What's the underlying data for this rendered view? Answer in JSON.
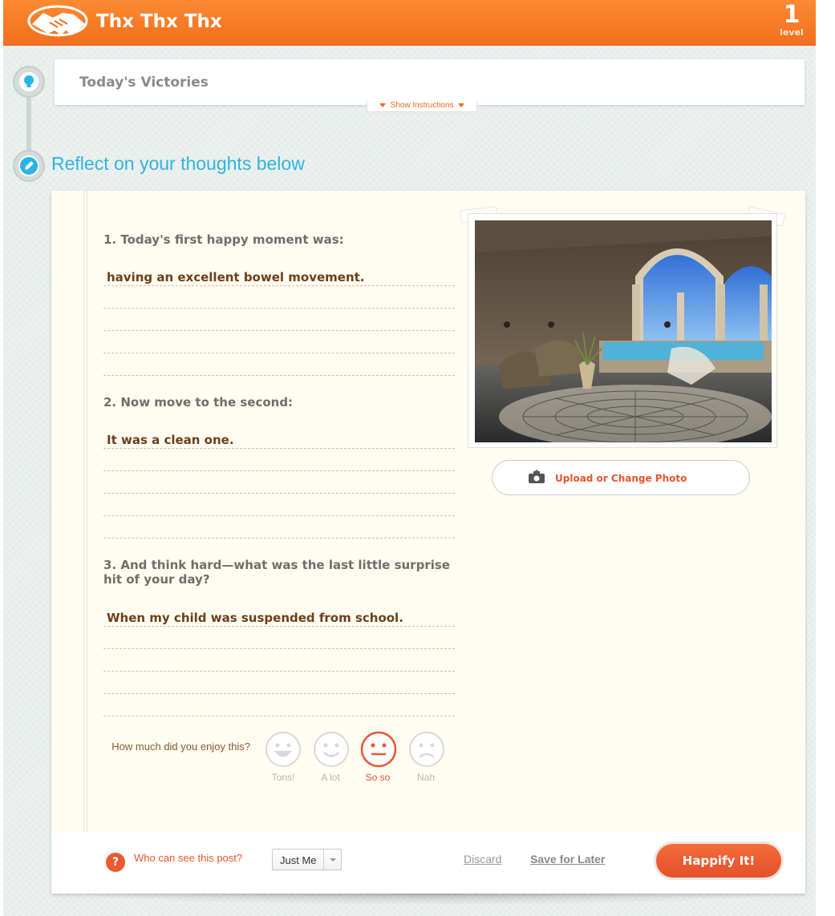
{
  "header": {
    "app_title": "Thx Thx Thx",
    "level_number": "1",
    "level_label": "level"
  },
  "steps": {
    "victories_title": "Today's Victories",
    "show_instructions": "Show Instructions",
    "reflect_title": "Reflect on your thoughts below"
  },
  "questions": [
    {
      "prompt": "1. Today's first happy moment was:",
      "answer": "having an excellent bowel movement."
    },
    {
      "prompt": "2. Now move to the second:",
      "answer": "It was a clean one."
    },
    {
      "prompt": "3. And think hard—what was the last little surprise hit of your day?",
      "answer": "When my child was suspended from school."
    }
  ],
  "photo": {
    "upload_label": "Upload or Change Photo"
  },
  "enjoy": {
    "question": "How much did you enjoy this?",
    "options": [
      "Tons!",
      "A lot",
      "So so",
      "Nah"
    ],
    "selected": "So so"
  },
  "footer": {
    "who_label": "Who can see this post?",
    "visibility_value": "Just Me",
    "discard_label": "Discard",
    "save_later_label": "Save for Later",
    "submit_label": "Happify It!"
  },
  "colors": {
    "brand_orange": "#f36f1d",
    "accent_blue": "#2fb4df",
    "accent_red": "#e8552e"
  }
}
